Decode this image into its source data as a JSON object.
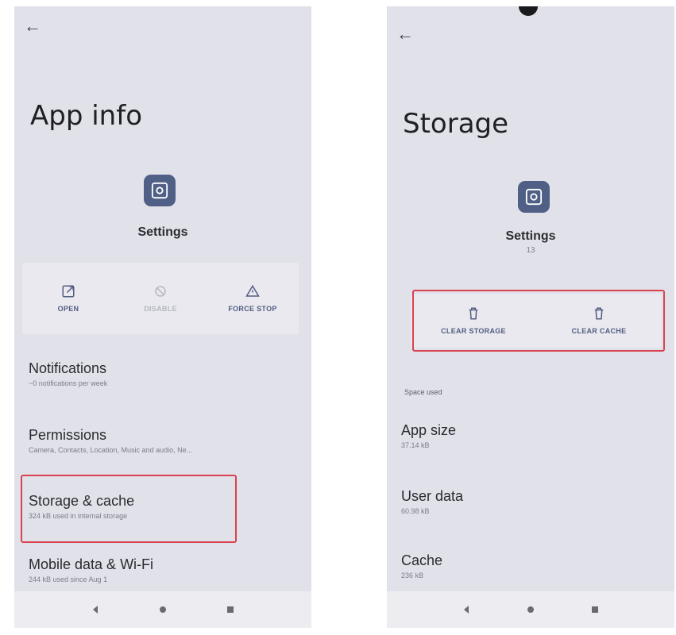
{
  "left": {
    "back_icon": "arrow-left-icon",
    "title": "App info",
    "app": {
      "name": "Settings",
      "icon": "gear-icon"
    },
    "actions": [
      {
        "label": "OPEN",
        "icon": "open-external-icon",
        "enabled": true
      },
      {
        "label": "DISABLE",
        "icon": "disable-icon",
        "enabled": false
      },
      {
        "label": "FORCE STOP",
        "icon": "warning-icon",
        "enabled": true
      }
    ],
    "items": [
      {
        "title": "Notifications",
        "subtitle": "~0 notifications per week"
      },
      {
        "title": "Permissions",
        "subtitle": "Camera, Contacts, Location, Music and audio, Ne..."
      },
      {
        "title": "Storage & cache",
        "subtitle": "324 kB used in internal storage",
        "highlighted": true
      },
      {
        "title": "Mobile data & Wi-Fi",
        "subtitle": "244 kB used since Aug 1"
      }
    ]
  },
  "right": {
    "back_icon": "arrow-left-icon",
    "title": "Storage",
    "app": {
      "name": "Settings",
      "version": "13",
      "icon": "gear-icon"
    },
    "actions": [
      {
        "label": "CLEAR STORAGE",
        "icon": "trash-icon"
      },
      {
        "label": "CLEAR CACHE",
        "icon": "trash-icon"
      }
    ],
    "section_header": "Space used",
    "items": [
      {
        "title": "App size",
        "subtitle": "37.14 kB"
      },
      {
        "title": "User data",
        "subtitle": "60.98 kB"
      },
      {
        "title": "Cache",
        "subtitle": "236 kB"
      }
    ]
  },
  "navbar": {
    "back": "triangle-back-icon",
    "home": "circle-home-icon",
    "recents": "square-recents-icon"
  },
  "colors": {
    "background": "#e1e1ea",
    "accent": "#4f5f86",
    "highlight": "#d9424f"
  }
}
